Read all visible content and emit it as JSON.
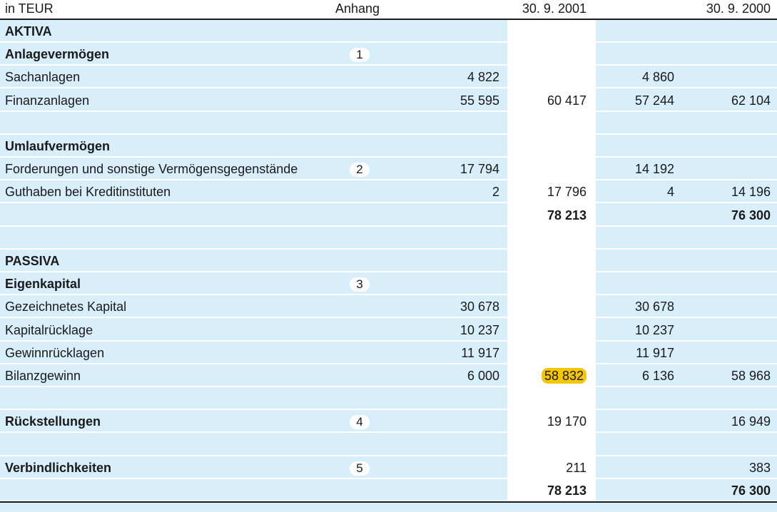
{
  "header": {
    "unit": "in TEUR",
    "note_col": "Anhang",
    "col_2001": "30. 9. 2001",
    "col_2000": "30. 9. 2000"
  },
  "rows": [
    {
      "label": "AKTIVA",
      "bold": true
    },
    {
      "label": "Anlagevermögen",
      "bold": true,
      "note": "1"
    },
    {
      "label": "Sachanlagen",
      "c1": "4 822",
      "c3": "4 860"
    },
    {
      "label": "Finanzanlagen",
      "c1": "55 595",
      "c2": "60 417",
      "c3": "57 244",
      "c4": "62 104"
    },
    {},
    {
      "label": "Umlaufvermögen",
      "bold": true
    },
    {
      "label": "Forderungen und sonstige Vermögensgegenstände",
      "note": "2",
      "c1": "17 794",
      "c3": "14 192"
    },
    {
      "label": "Guthaben bei Kreditinstituten",
      "c1": "2",
      "c2": "17 796",
      "c3": "4",
      "c4": "14 196"
    },
    {
      "c2": "78 213",
      "c4": "76 300",
      "totals_bold": true
    },
    {},
    {
      "label": "PASSIVA",
      "bold": true
    },
    {
      "label": "Eigenkapital",
      "bold": true,
      "note": "3"
    },
    {
      "label": "Gezeichnetes Kapital",
      "c1": "30 678",
      "c3": "30 678"
    },
    {
      "label": "Kapitalrücklage",
      "c1": "10 237",
      "c3": "10 237"
    },
    {
      "label": "Gewinnrücklagen",
      "c1": "11 917",
      "c3": "11 917"
    },
    {
      "label": "Bilanzgewinn",
      "c1": "6 000",
      "c2": "58 832",
      "c3": "6 136",
      "c4": "58 968",
      "c2_highlight": true
    },
    {},
    {
      "label": "Rückstellungen",
      "bold": true,
      "note": "4",
      "c2": "19 170",
      "c4": "16 949"
    },
    {},
    {
      "label": "Verbindlichkeiten",
      "bold": true,
      "note": "5",
      "c2": "211",
      "c4": "383"
    },
    {
      "c2": "78 213",
      "c4": "76 300",
      "totals_bold": true
    }
  ],
  "colors": {
    "band": "#d8eefa",
    "highlight": "#f6c600",
    "rule": "#1a1a1a"
  }
}
